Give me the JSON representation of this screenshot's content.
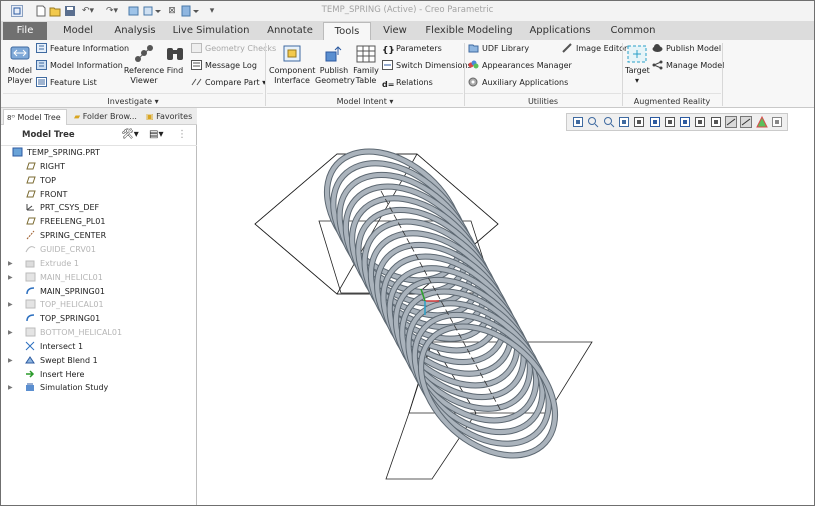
{
  "window": {
    "title": "TEMP_SPRING (Active) - Creo Parametric"
  },
  "quick_access": [
    "app-menu-icon",
    "new-icon",
    "open-icon",
    "save-icon",
    "undo-icon",
    "redo-icon",
    "regenerate-icon",
    "windows-icon",
    "close-window-icon",
    "customize-icon"
  ],
  "tabs": [
    "File",
    "Model",
    "Analysis",
    "Live Simulation",
    "Annotate",
    "Tools",
    "View",
    "Flexible Modeling",
    "Applications",
    "Common"
  ],
  "active_tab": "Tools",
  "ribbon": {
    "investigate": {
      "label": "Investigate",
      "model_player": [
        "Model",
        "Player"
      ],
      "feature_information": "Feature Information",
      "model_information": "Model Information",
      "feature_list": "Feature List",
      "reference_viewer": [
        "Reference",
        "Viewer"
      ],
      "find": "Find",
      "geometry_checks": "Geometry Checks",
      "message_log": "Message Log",
      "compare_part": "Compare Part"
    },
    "model_intent": {
      "label": "Model Intent",
      "component_interface": [
        "Component",
        "Interface"
      ],
      "publish_geometry": [
        "Publish",
        "Geometry"
      ],
      "family_table": [
        "Family",
        "Table"
      ],
      "parameters": "Parameters",
      "switch_dimensions": "Switch Dimensions",
      "relations": "Relations"
    },
    "utilities": {
      "label": "Utilities",
      "udf_library": "UDF Library",
      "appearances_manager": "Appearances Manager",
      "auxiliary_applications": "Auxiliary Applications",
      "image_editor": "Image Editor"
    },
    "augmented_reality": {
      "label": "Augmented Reality",
      "target": "Target",
      "publish_model": "Publish Model",
      "manage_model": "Manage Model"
    }
  },
  "left_panel": {
    "tabs": [
      "Model Tree",
      "Folder Brow...",
      "Favorites"
    ],
    "header": "Model Tree",
    "nodes": [
      {
        "label": "TEMP_SPRING.PRT",
        "icon": "part-icon",
        "expander": false,
        "dim": false
      },
      {
        "label": "RIGHT",
        "icon": "datum-plane-icon",
        "expander": false,
        "dim": false
      },
      {
        "label": "TOP",
        "icon": "datum-plane-icon",
        "expander": false,
        "dim": false
      },
      {
        "label": "FRONT",
        "icon": "datum-plane-icon",
        "expander": false,
        "dim": false
      },
      {
        "label": "PRT_CSYS_DEF",
        "icon": "csys-icon",
        "expander": false,
        "dim": false
      },
      {
        "label": "FREELENG_PL01",
        "icon": "datum-plane-icon",
        "expander": false,
        "dim": false
      },
      {
        "label": "SPRING_CENTER",
        "icon": "axis-icon",
        "expander": false,
        "dim": false
      },
      {
        "label": "GUIDE_CRV01",
        "icon": "curve-icon",
        "expander": false,
        "dim": true
      },
      {
        "label": "Extrude 1",
        "icon": "extrude-icon",
        "expander": true,
        "dim": true
      },
      {
        "label": "MAIN_HELICL01",
        "icon": "helical-icon",
        "expander": true,
        "dim": true
      },
      {
        "label": "MAIN_SPRING01",
        "icon": "sweep-icon",
        "expander": false,
        "dim": false
      },
      {
        "label": "TOP_HELICAL01",
        "icon": "helical-icon",
        "expander": true,
        "dim": true
      },
      {
        "label": "TOP_SPRING01",
        "icon": "sweep-icon",
        "expander": false,
        "dim": false
      },
      {
        "label": "BOTTOM_HELICAL01",
        "icon": "helical-icon",
        "expander": true,
        "dim": true
      },
      {
        "label": "Intersect 1",
        "icon": "intersect-icon",
        "expander": false,
        "dim": false
      },
      {
        "label": "Swept Blend 1",
        "icon": "swept-blend-icon",
        "expander": true,
        "dim": false
      },
      {
        "label": "Insert Here",
        "icon": "insert-arrow-icon",
        "expander": false,
        "dim": false
      },
      {
        "label": "Simulation Study",
        "icon": "simulation-icon",
        "expander": true,
        "dim": false
      }
    ]
  },
  "viewport_toolbar": [
    "refit-icon",
    "zoom-in-icon",
    "zoom-out-icon",
    "repaint-icon",
    "spin-center-icon",
    "display-style-icon",
    "saved-orientations-icon",
    "named-views-icon",
    "view-manager-icon",
    "perspective-icon",
    "datum-display-icon",
    "annotation-display-icon",
    "appearance-icon",
    "section-icon"
  ],
  "colors": {
    "accent_blue": "#2c6fbf",
    "file_tab": "#707070",
    "spring": "#aab3bc"
  }
}
